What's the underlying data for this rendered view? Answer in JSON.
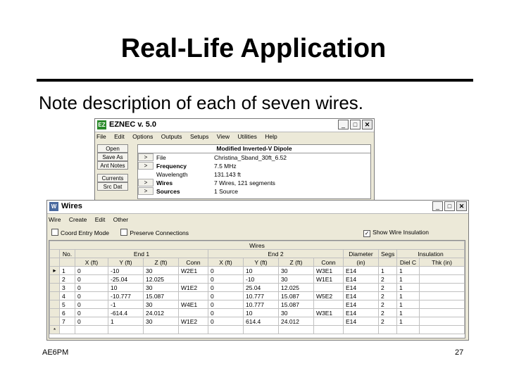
{
  "slide": {
    "title": "Real-Life Application",
    "subtitle": "Note description of each of seven wires.",
    "footer_left": "AE6PM",
    "footer_right": "27"
  },
  "main_window": {
    "title": "EZNEC v. 5.0",
    "menu": [
      "File",
      "Edit",
      "Options",
      "Outputs",
      "Setups",
      "View",
      "Utilities",
      "Help"
    ],
    "side_buttons": [
      "Open",
      "Save As",
      "Ant Notes",
      "Currents",
      "Src Dat"
    ],
    "grid_header": "Modified Inverted-V Dipole",
    "rows": [
      {
        "arrow": ">",
        "label": "File",
        "value": "Christina_Sband_30ft_6.52"
      },
      {
        "arrow": ">",
        "label": "Frequency",
        "value": "7.5 MHz"
      },
      {
        "arrow": "",
        "label": "Wavelength",
        "value": "131.143 ft"
      },
      {
        "arrow": ">",
        "label": "Wires",
        "value": "7 Wires, 121 segments"
      },
      {
        "arrow": ">",
        "label": "Sources",
        "value": "1 Source"
      }
    ]
  },
  "wires_window": {
    "title": "Wires",
    "menu": [
      "Wire",
      "Create",
      "Edit",
      "Other"
    ],
    "options": {
      "coord_entry": "Coord Entry Mode",
      "preserve": "Preserve Connections",
      "show_insulation": "Show Wire Insulation"
    },
    "group_header": "Wires",
    "col_groups": [
      "No.",
      "End 1",
      "End 2",
      "Diameter",
      "Segs",
      "Insulation"
    ],
    "columns": [
      "X (ft)",
      "Y (ft)",
      "Z (ft)",
      "Conn",
      "X (ft)",
      "Y (ft)",
      "Z (ft)",
      "Conn",
      "(in)",
      "",
      "Diel C",
      "Thk (in)"
    ],
    "wires": [
      {
        "no": "1",
        "x1": "0",
        "y1": "-10",
        "z1": "30",
        "c1": "W2E1",
        "x2": "0",
        "y2": "10",
        "z2": "30",
        "c2": "W3E1",
        "dia": "E14",
        "segs": "1",
        "diel": "1",
        "thk": ""
      },
      {
        "no": "2",
        "x1": "0",
        "y1": "-25.04",
        "z1": "12.025",
        "c1": "",
        "x2": "0",
        "y2": "-10",
        "z2": "30",
        "c2": "W1E1",
        "dia": "E14",
        "segs": "2",
        "diel": "1",
        "thk": ""
      },
      {
        "no": "3",
        "x1": "0",
        "y1": "10",
        "z1": "30",
        "c1": "W1E2",
        "x2": "0",
        "y2": "25.04",
        "z2": "12.025",
        "c2": "",
        "dia": "E14",
        "segs": "2",
        "diel": "1",
        "thk": ""
      },
      {
        "no": "4",
        "x1": "0",
        "y1": "-10.777",
        "z1": "15.087",
        "c1": "",
        "x2": "0",
        "y2": "10.777",
        "z2": "15.087",
        "c2": "W5E2",
        "dia": "E14",
        "segs": "2",
        "diel": "1",
        "thk": ""
      },
      {
        "no": "5",
        "x1": "0",
        "y1": "-1",
        "z1": "30",
        "c1": "W4E1",
        "x2": "0",
        "y2": "10.777",
        "z2": "15.087",
        "c2": "",
        "dia": "E14",
        "segs": "2",
        "diel": "1",
        "thk": ""
      },
      {
        "no": "6",
        "x1": "0",
        "y1": "-614.4",
        "z1": "24.012",
        "c1": "",
        "x2": "0",
        "y2": "10",
        "z2": "30",
        "c2": "W3E1",
        "dia": "E14",
        "segs": "2",
        "diel": "1",
        "thk": ""
      },
      {
        "no": "7",
        "x1": "0",
        "y1": "1",
        "z1": "30",
        "c1": "W1E2",
        "x2": "0",
        "y2": "614.4",
        "z2": "24.012",
        "c2": "",
        "dia": "E14",
        "segs": "2",
        "diel": "1",
        "thk": ""
      }
    ]
  }
}
